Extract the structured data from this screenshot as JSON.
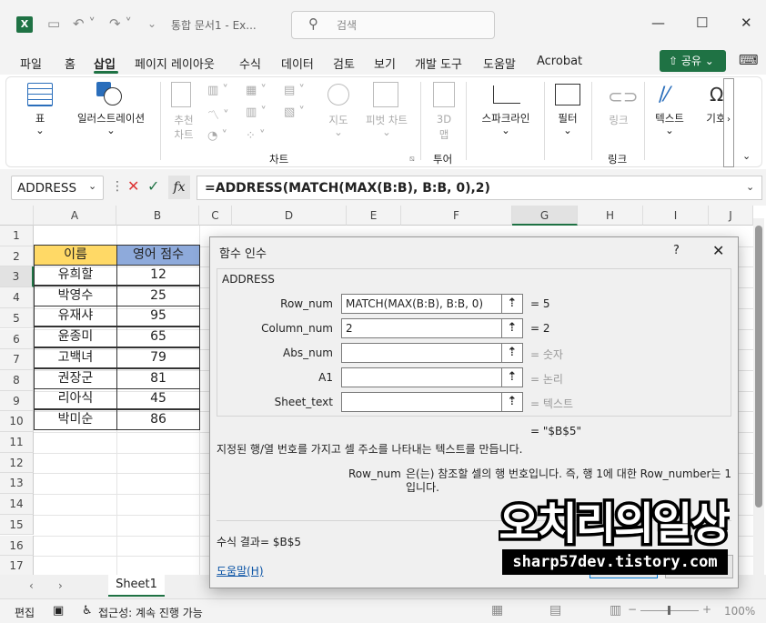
{
  "titlebar": {
    "doc_title": "통합 문서1 - Ex...",
    "search_placeholder": "검색"
  },
  "menu": {
    "items": [
      "파일",
      "홈",
      "삽입",
      "페이지 레이아웃",
      "수식",
      "데이터",
      "검토",
      "보기",
      "개발 도구",
      "도움말",
      "Acrobat"
    ],
    "share": "공유"
  },
  "ribbon": {
    "table": "표",
    "illustration": "일러스트레이션",
    "recommended_chart": [
      "추천",
      "차트"
    ],
    "map": "지도",
    "pivot_chart": "피벗 차트",
    "map3d": [
      "3D",
      "맵"
    ],
    "sparkline": "스파크라인",
    "filter": "필터",
    "link": "링크",
    "text": "텍스트",
    "symbol": "기호",
    "groups": {
      "chart": "차트",
      "tour": "투어",
      "link": "링크"
    }
  },
  "formula_bar": {
    "name_box": "ADDRESS",
    "fx": "fx",
    "formula": "=ADDRESS(MATCH(MAX(B:B), B:B, 0),2)"
  },
  "columns": [
    "A",
    "B",
    "C",
    "D",
    "E",
    "F",
    "G",
    "H",
    "I",
    "J"
  ],
  "rows": [
    "1",
    "2",
    "3",
    "4",
    "5",
    "6",
    "7",
    "8",
    "9",
    "10",
    "11",
    "12",
    "13",
    "14",
    "15",
    "16",
    "17"
  ],
  "table": {
    "headers": [
      "이름",
      "영어 점수"
    ],
    "rows": [
      [
        "유희할",
        "12"
      ],
      [
        "박영수",
        "25"
      ],
      [
        "유재샤",
        "95"
      ],
      [
        "윤종미",
        "65"
      ],
      [
        "고백녀",
        "79"
      ],
      [
        "권장군",
        "81"
      ],
      [
        "리아식",
        "45"
      ],
      [
        "박미순",
        "86"
      ]
    ]
  },
  "sheet": {
    "tab": "Sheet1"
  },
  "status": {
    "mode": "편집",
    "accessibility": "접근성: 계속 진행 가능",
    "zoom": "100%"
  },
  "dialog": {
    "title": "함수 인수",
    "help": "?",
    "function_name": "ADDRESS",
    "args": [
      {
        "label": "Row_num",
        "value": "MATCH(MAX(B:B), B:B, 0)",
        "result": "=  5",
        "dim": false
      },
      {
        "label": "Column_num",
        "value": "2",
        "result": "=  2",
        "dim": false
      },
      {
        "label": "Abs_num",
        "value": "",
        "result": "=  숫자",
        "dim": true
      },
      {
        "label": "A1",
        "value": "",
        "result": "=  논리",
        "dim": true
      },
      {
        "label": "Sheet_text",
        "value": "",
        "result": "=  텍스트",
        "dim": true
      }
    ],
    "overall_result": "=  \"$B$5\"",
    "description": "지정된 행/열 번호를 가지고 셀 주소를 나타내는 텍스트를 만듭니다.",
    "arg_desc_name": "Row_num",
    "arg_desc": "은(는) 참조할 셀의 행 번호입니다. 즉, 행 1에 대한 Row_number는 1입니다.",
    "formula_result": "수식 결과=   $B$5",
    "help_link": "도움말(H)"
  },
  "watermark": {
    "main": "오치리의일상",
    "sub": "sharp57dev.tistory.com"
  }
}
